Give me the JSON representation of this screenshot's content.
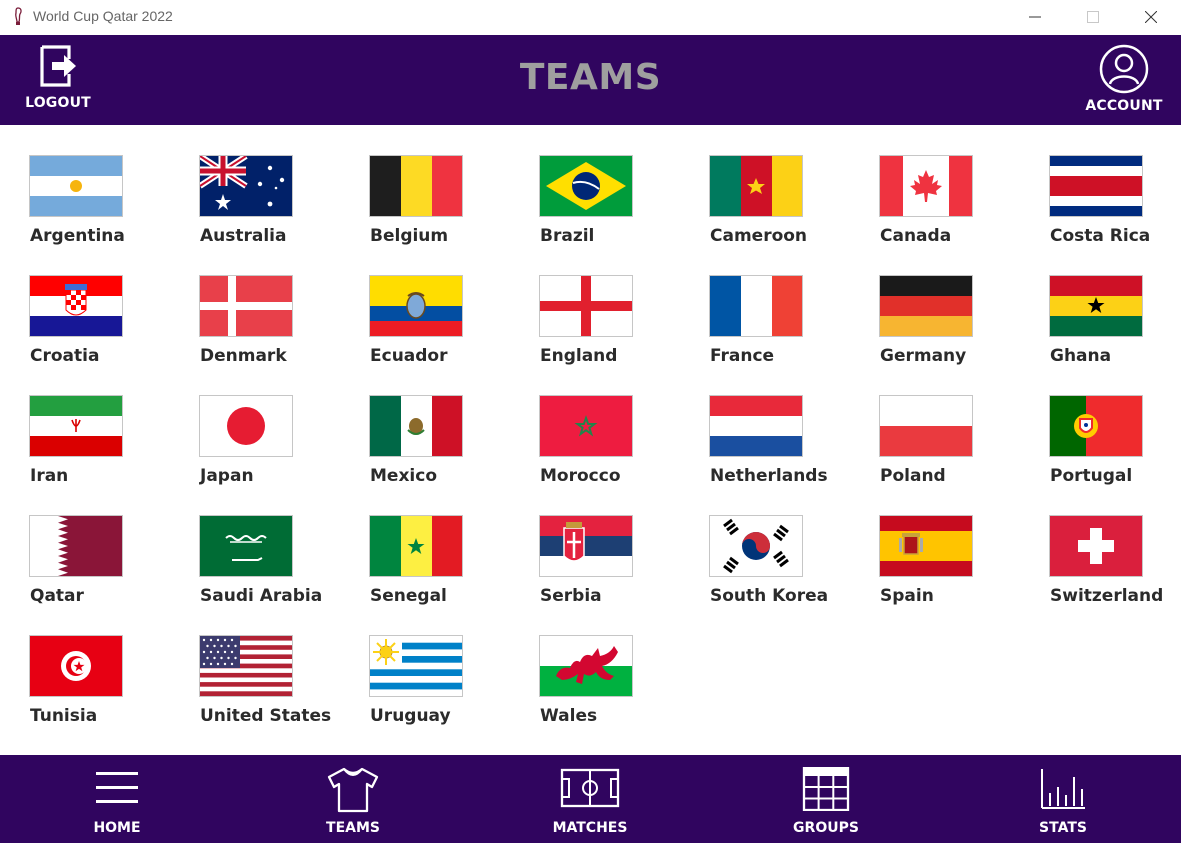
{
  "window": {
    "title": "World Cup Qatar 2022",
    "controls": [
      "minimize-icon",
      "maximize-icon",
      "close-icon"
    ]
  },
  "header": {
    "title": "TEAMS",
    "logout_label": "LOGOUT",
    "account_label": "ACCOUNT",
    "background": "#30055f",
    "title_color": "#9f9f9f"
  },
  "teams": [
    {
      "name": "Argentina"
    },
    {
      "name": "Australia"
    },
    {
      "name": "Belgium"
    },
    {
      "name": "Brazil"
    },
    {
      "name": "Cameroon"
    },
    {
      "name": "Canada"
    },
    {
      "name": "Costa Rica"
    },
    {
      "name": "Croatia"
    },
    {
      "name": "Denmark"
    },
    {
      "name": "Ecuador"
    },
    {
      "name": "England"
    },
    {
      "name": "France"
    },
    {
      "name": "Germany"
    },
    {
      "name": "Ghana"
    },
    {
      "name": "Iran"
    },
    {
      "name": "Japan"
    },
    {
      "name": "Mexico"
    },
    {
      "name": "Morocco"
    },
    {
      "name": "Netherlands"
    },
    {
      "name": "Poland"
    },
    {
      "name": "Portugal"
    },
    {
      "name": "Qatar"
    },
    {
      "name": "Saudi Arabia"
    },
    {
      "name": "Senegal"
    },
    {
      "name": "Serbia"
    },
    {
      "name": "South Korea"
    },
    {
      "name": "Spain"
    },
    {
      "name": "Switzerland"
    },
    {
      "name": "Tunisia"
    },
    {
      "name": "United States"
    },
    {
      "name": "Uruguay"
    },
    {
      "name": "Wales"
    }
  ],
  "nav": {
    "home_label": "HOME",
    "teams_label": "TEAMS",
    "matches_label": "MATCHES",
    "groups_label": "GROUPS",
    "stats_label": "STATS"
  }
}
